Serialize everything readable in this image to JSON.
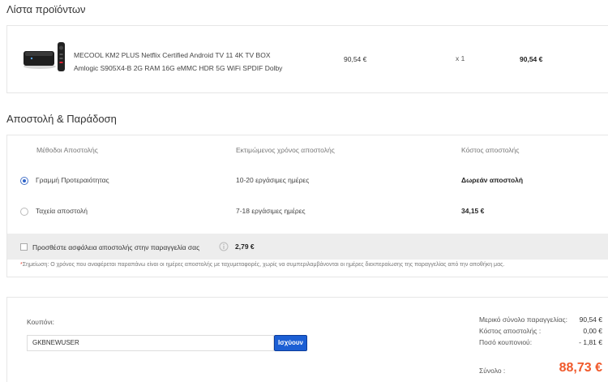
{
  "sections": {
    "products_title": "Λίστα προϊόντων",
    "shipping_title": "Αποστολή & Παράδοση"
  },
  "product": {
    "name_line1": "MECOOL KM2 PLUS Netflix Certified Android TV 11 4K TV BOX",
    "name_line2": "Amlogic S905X4-B 2G RAM 16G eMMC HDR 5G WiFi SPDIF Dolby",
    "unit_price": "90,54 €",
    "quantity": "x 1",
    "line_total": "90,54 €",
    "image_icon": "tv-box-with-remote-icon"
  },
  "shipping": {
    "headers": {
      "method": "Μέθοδοι Αποστολής",
      "time": "Εκτιμώμενος χρόνος αποστολής",
      "cost": "Κόστος αποστολής"
    },
    "options": [
      {
        "name": "Γραμμή Προτεραιότητας",
        "time": "10-20 εργάσιμες ημέρες",
        "cost": "Δωρεάν αποστολή",
        "selected": true
      },
      {
        "name": "Ταχεία αποστολή",
        "time": "7-18 εργάσιμες ημέρες",
        "cost": "34,15 €",
        "selected": false
      }
    ],
    "insurance": {
      "label": "Προσθέστε ασφάλεια αποστολής στην παραγγελία σας",
      "price": "2,79 €",
      "checked": false,
      "icon": "info-icon"
    },
    "note_star": "*",
    "note": "Σημείωση: Ο χρόνος που αναφέρεται παραπάνω είναι οι ημέρες αποστολής με ταχυμεταφορές, χωρίς να συμπεριλαμβάνονται οι ημέρες διεκπεραίωσης της παραγγελίας από την αποθήκη μας."
  },
  "coupon": {
    "label": "Κουπόνι:",
    "value": "GKBNEWUSER",
    "apply_label": "Ισχύουν"
  },
  "summary": {
    "subtotal_label": "Μερικό σύνολο παραγγελίας:",
    "subtotal": "90,54 €",
    "shipping_label": "Κόστος αποστολής :",
    "shipping": "0,00 €",
    "coupon_label": "Ποσό κουπονιού:",
    "coupon": "- 1,81 €",
    "total_label": "Σύνολο :",
    "total": "88,73 €"
  },
  "colors": {
    "accent": "#1c5fd4",
    "total": "#f0592b",
    "note_star": "#e74c3c"
  }
}
